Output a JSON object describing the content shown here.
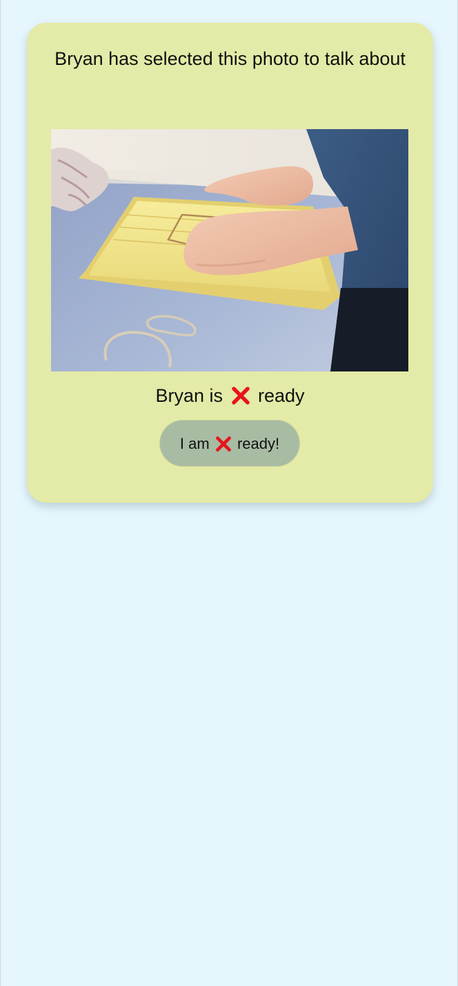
{
  "card": {
    "title": "Bryan has selected this photo to talk about"
  },
  "photo": {
    "icon": "photo-of-child-with-geoboard"
  },
  "status": {
    "prefix": "Bryan is",
    "icon": "cross-mark-icon",
    "suffix": "ready"
  },
  "ready_button": {
    "prefix": "I am",
    "icon": "cross-mark-icon",
    "suffix": "ready!"
  },
  "colors": {
    "background": "#e5f6fd",
    "card": "#e4eaa7",
    "button": "#a8bca3",
    "cross": "#e8141c"
  }
}
